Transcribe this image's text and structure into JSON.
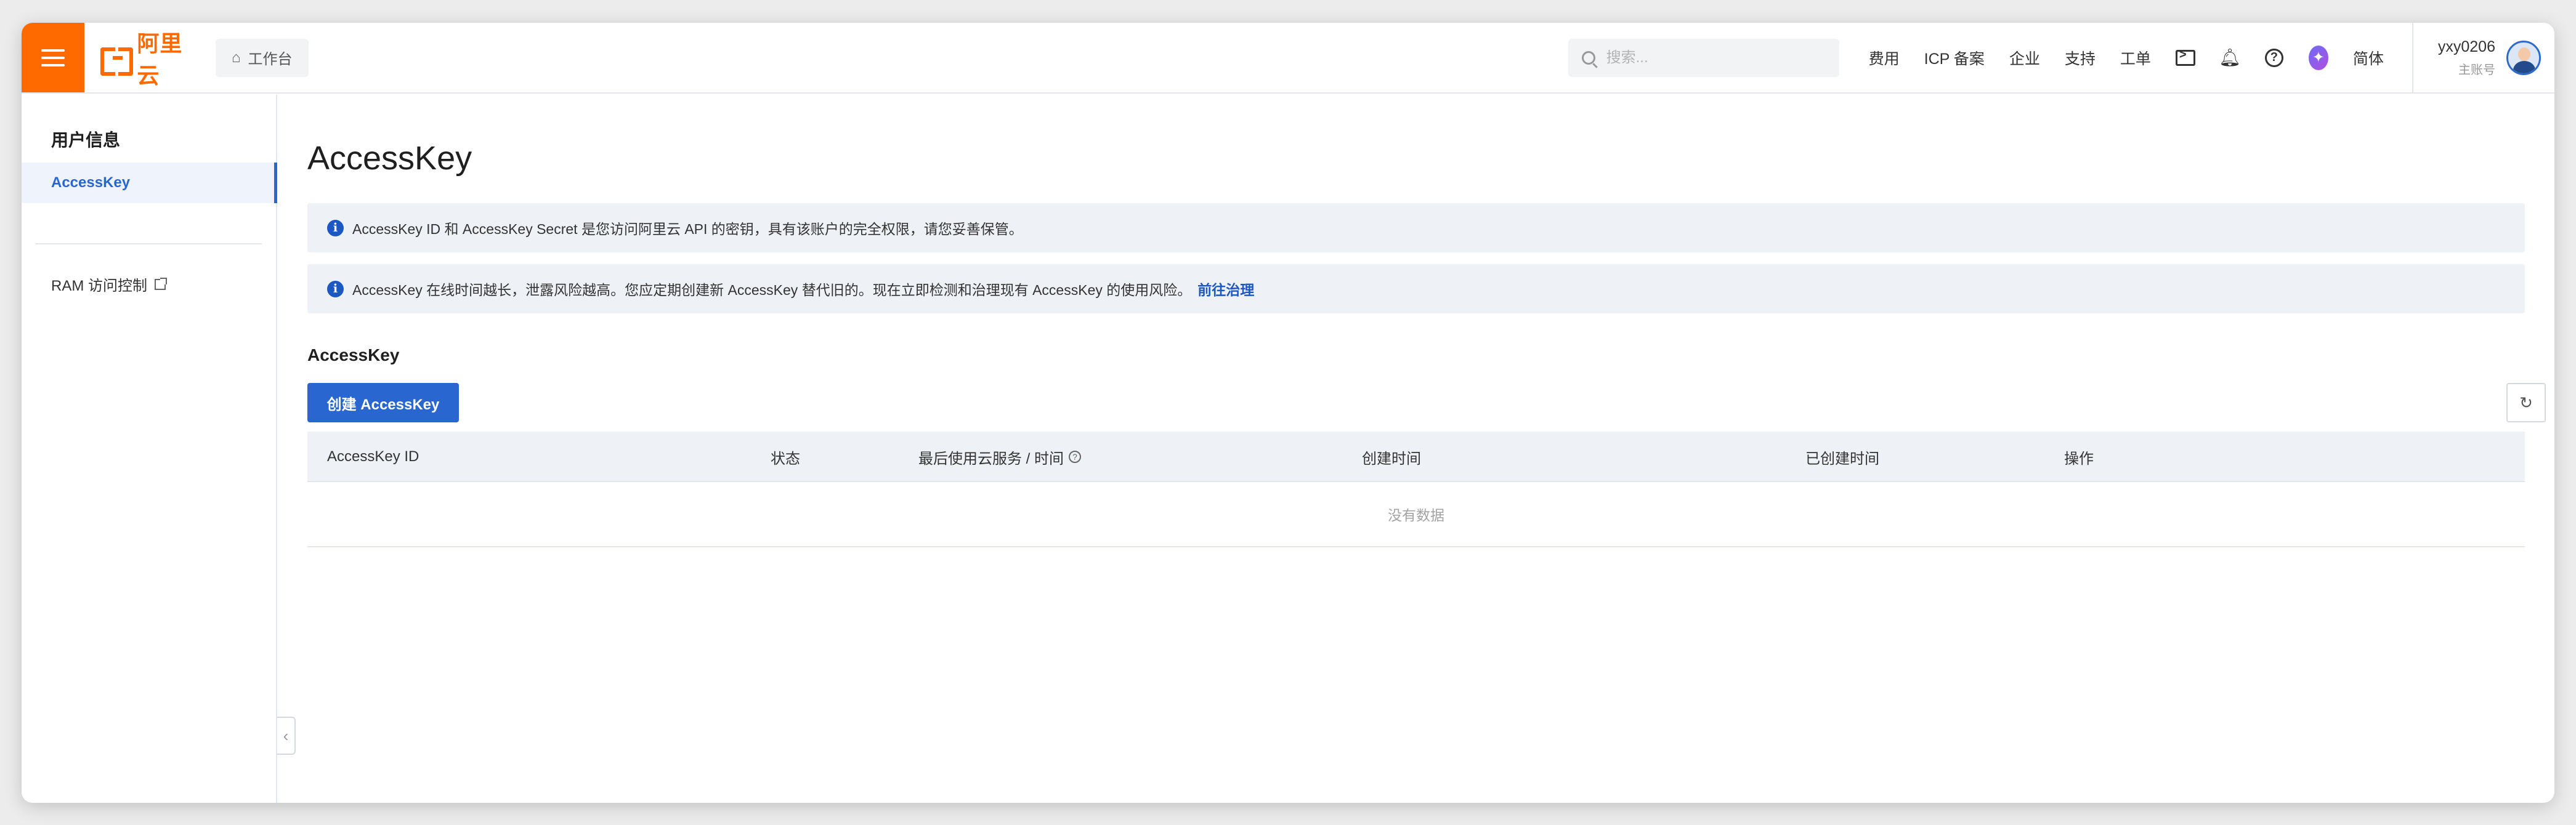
{
  "header": {
    "logo_text": "阿里云",
    "workbench_label": "工作台",
    "search_placeholder": "搜索...",
    "nav_links": [
      "费用",
      "ICP 备案",
      "企业",
      "支持",
      "工单"
    ],
    "language": "简体",
    "user_name": "yxy0206",
    "user_role": "主账号",
    "accent_color": "#ff6a00"
  },
  "sidebar": {
    "title": "用户信息",
    "items": [
      {
        "label": "AccessKey",
        "active": true
      },
      {
        "label": "RAM 访问控制",
        "external": true
      }
    ]
  },
  "main": {
    "title": "AccessKey",
    "notices": [
      {
        "text": "AccessKey ID 和 AccessKey Secret 是您访问阿里云 API 的密钥，具有该账户的完全权限，请您妥善保管。"
      },
      {
        "text": "AccessKey 在线时间越长，泄露风险越高。您应定期创建新 AccessKey 替代旧的。现在立即检测和治理现有 AccessKey 的使用风险。",
        "link": "前往治理"
      }
    ],
    "section_title": "AccessKey",
    "create_button": "创建 AccessKey",
    "table": {
      "columns": [
        "AccessKey ID",
        "状态",
        "最后使用云服务 / 时间",
        "创建时间",
        "已创建时间",
        "操作"
      ],
      "empty_text": "没有数据"
    },
    "primary_color": "#2a66d0"
  }
}
